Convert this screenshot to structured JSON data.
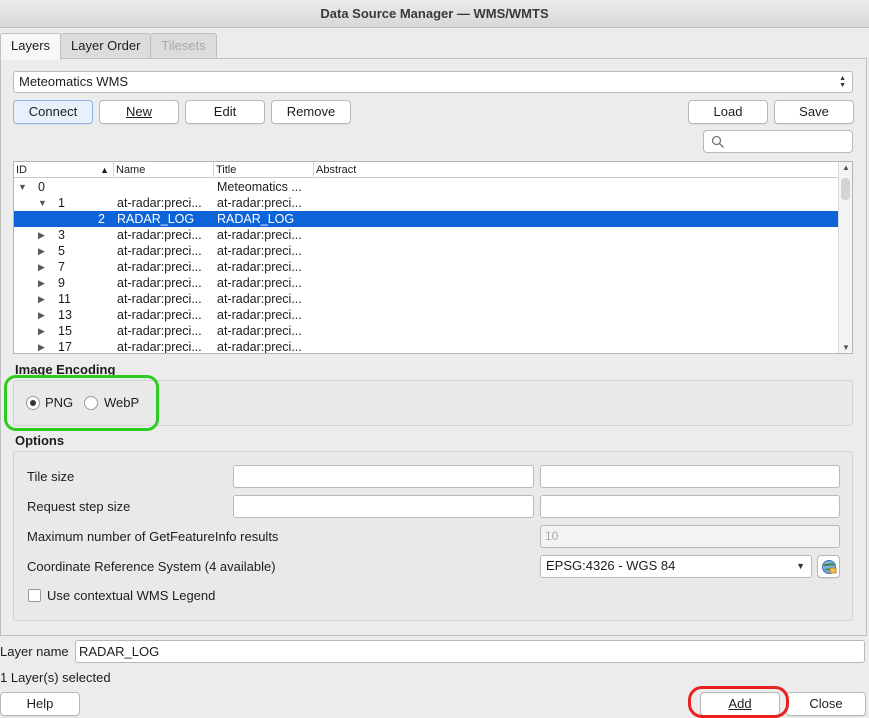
{
  "window": {
    "title": "Data Source Manager — WMS/WMTS"
  },
  "tabs": [
    {
      "label": "Layers",
      "active": true
    },
    {
      "label": "Layer Order",
      "active": false
    },
    {
      "label": "Tilesets",
      "active": false,
      "disabled": true
    }
  ],
  "connection": {
    "selected": "Meteomatics WMS",
    "buttons": {
      "connect": "Connect",
      "new": "New",
      "edit": "Edit",
      "remove": "Remove",
      "load": "Load",
      "save": "Save"
    },
    "search_placeholder": ""
  },
  "tree": {
    "columns": [
      "ID",
      "Name",
      "Title",
      "Abstract"
    ],
    "rows": [
      {
        "id": "0",
        "name": "",
        "title": "Meteomatics ...",
        "expanded": true,
        "level": 0,
        "selected": false
      },
      {
        "id": "1",
        "name": "at-radar:preci...",
        "title": "at-radar:preci...",
        "expanded": true,
        "level": 1,
        "selected": false
      },
      {
        "id": "2",
        "name": "RADAR_LOG",
        "title": "RADAR_LOG",
        "expanded": null,
        "level": 2,
        "selected": true
      },
      {
        "id": "3",
        "name": "at-radar:preci...",
        "title": "at-radar:preci...",
        "expanded": false,
        "level": 1,
        "selected": false
      },
      {
        "id": "5",
        "name": "at-radar:preci...",
        "title": "at-radar:preci...",
        "expanded": false,
        "level": 1,
        "selected": false
      },
      {
        "id": "7",
        "name": "at-radar:preci...",
        "title": "at-radar:preci...",
        "expanded": false,
        "level": 1,
        "selected": false
      },
      {
        "id": "9",
        "name": "at-radar:preci...",
        "title": "at-radar:preci...",
        "expanded": false,
        "level": 1,
        "selected": false
      },
      {
        "id": "11",
        "name": "at-radar:preci...",
        "title": "at-radar:preci...",
        "expanded": false,
        "level": 1,
        "selected": false
      },
      {
        "id": "13",
        "name": "at-radar:preci...",
        "title": "at-radar:preci...",
        "expanded": false,
        "level": 1,
        "selected": false
      },
      {
        "id": "15",
        "name": "at-radar:preci...",
        "title": "at-radar:preci...",
        "expanded": false,
        "level": 1,
        "selected": false
      },
      {
        "id": "17",
        "name": "at-radar:preci...",
        "title": "at-radar:preci...",
        "expanded": false,
        "level": 1,
        "selected": false
      }
    ]
  },
  "image_encoding": {
    "title": "Image Encoding",
    "options": [
      {
        "label": "PNG",
        "checked": true
      },
      {
        "label": "WebP",
        "checked": false
      }
    ]
  },
  "options": {
    "title": "Options",
    "tile_size_label": "Tile size",
    "request_step_label": "Request step size",
    "max_getfeatureinfo_label": "Maximum number of GetFeatureInfo results",
    "max_getfeatureinfo_value": "10",
    "crs_label": "Coordinate Reference System (4 available)",
    "crs_value": "EPSG:4326 - WGS 84",
    "contextual_legend_label": "Use contextual WMS Legend"
  },
  "layer_name": {
    "label": "Layer name",
    "value": "RADAR_LOG"
  },
  "status": "1 Layer(s) selected",
  "footer": {
    "help": "Help",
    "add": "Add",
    "close": "Close"
  },
  "colors": {
    "selection": "#0d63d8",
    "highlight_green": "#2ecc1f",
    "highlight_red": "#e8221f"
  }
}
